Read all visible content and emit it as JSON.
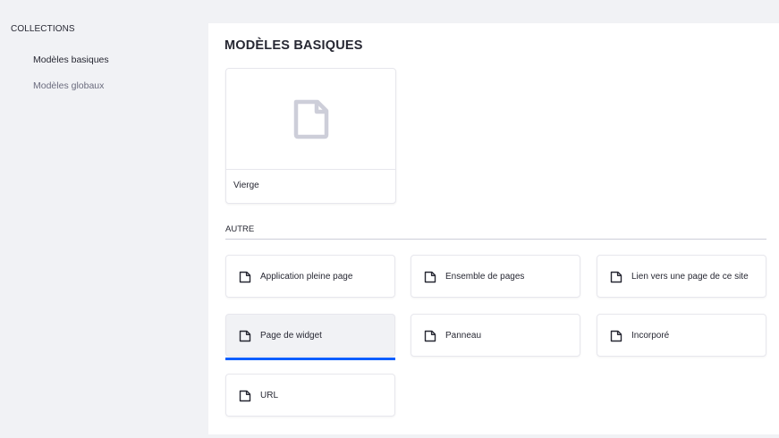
{
  "sidebar": {
    "header": "COLLECTIONS",
    "items": [
      {
        "label": "Modèles basiques",
        "active": true
      },
      {
        "label": "Modèles globaux",
        "active": false
      }
    ]
  },
  "main": {
    "title": "MODÈLES BASIQUES",
    "blank_card": {
      "label": "Vierge",
      "icon": "page-icon"
    },
    "other_section": {
      "label": "AUTRE",
      "tiles": [
        {
          "label": "Application pleine page",
          "icon": "page-icon"
        },
        {
          "label": "Ensemble de pages",
          "icon": "page-icon"
        },
        {
          "label": "Lien vers une page de ce site",
          "icon": "page-icon"
        },
        {
          "label": "Page de widget",
          "icon": "page-icon",
          "selected": true
        },
        {
          "label": "Panneau",
          "icon": "page-icon"
        },
        {
          "label": "Incorporé",
          "icon": "page-icon"
        },
        {
          "label": "URL",
          "icon": "page-icon"
        }
      ]
    }
  },
  "colors": {
    "accent": "#0b5fff",
    "background": "#f1f2f5",
    "card_border": "#e7e7ed",
    "text": "#272833",
    "muted_text": "#6b6c7e",
    "icon_gray": "#cdced9"
  }
}
